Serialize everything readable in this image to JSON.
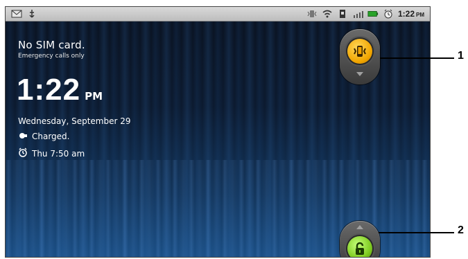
{
  "statusbar": {
    "time": "1:22",
    "ampm": "PM"
  },
  "lockscreen": {
    "sim_title": "No SIM card.",
    "sim_subtitle": "Emergency calls only",
    "clock_time": "1:22",
    "clock_ampm": "PM",
    "date": "Wednesday, September 29",
    "battery_status": "Charged.",
    "alarm": "Thu 7:50 am"
  },
  "callouts": {
    "top_label": "1",
    "bottom_label": "2"
  },
  "colors": {
    "vibrate_knob": "#f1a500",
    "unlock_knob": "#80cc22"
  }
}
